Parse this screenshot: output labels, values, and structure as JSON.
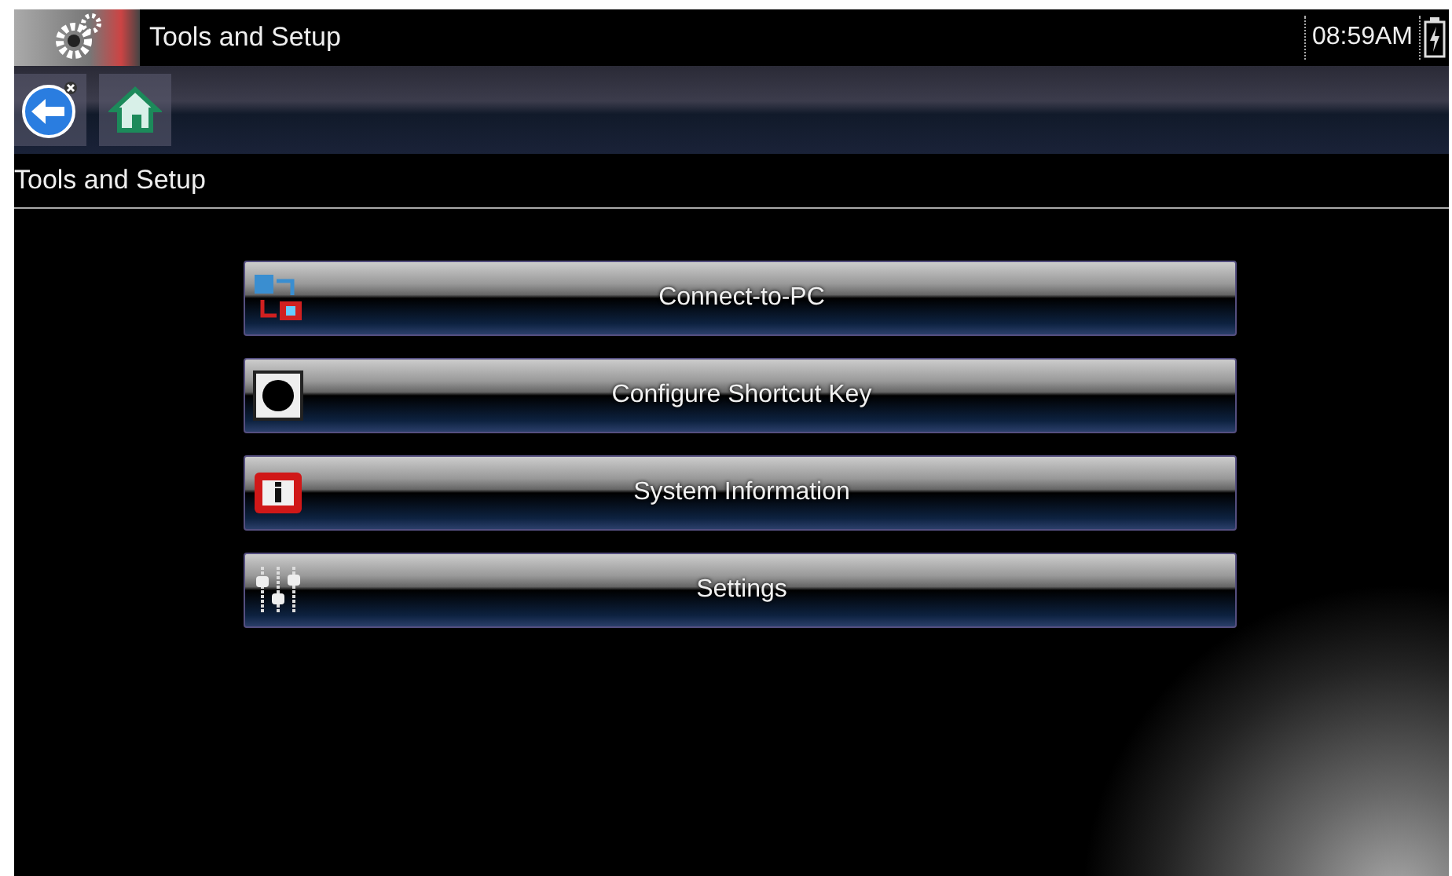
{
  "title_bar": {
    "title": "Tools and Setup",
    "time": "08:59AM"
  },
  "toolbar": {
    "buttons": [
      {
        "kind": "back"
      },
      {
        "kind": "home"
      }
    ]
  },
  "header": {
    "title": "Tools and Setup"
  },
  "menu": [
    {
      "label": "Connect-to-PC",
      "kind": "connect"
    },
    {
      "label": "Configure Shortcut Key",
      "kind": "shortcut"
    },
    {
      "label": "System Information",
      "kind": "info"
    },
    {
      "label": "Settings",
      "kind": "settings"
    }
  ]
}
